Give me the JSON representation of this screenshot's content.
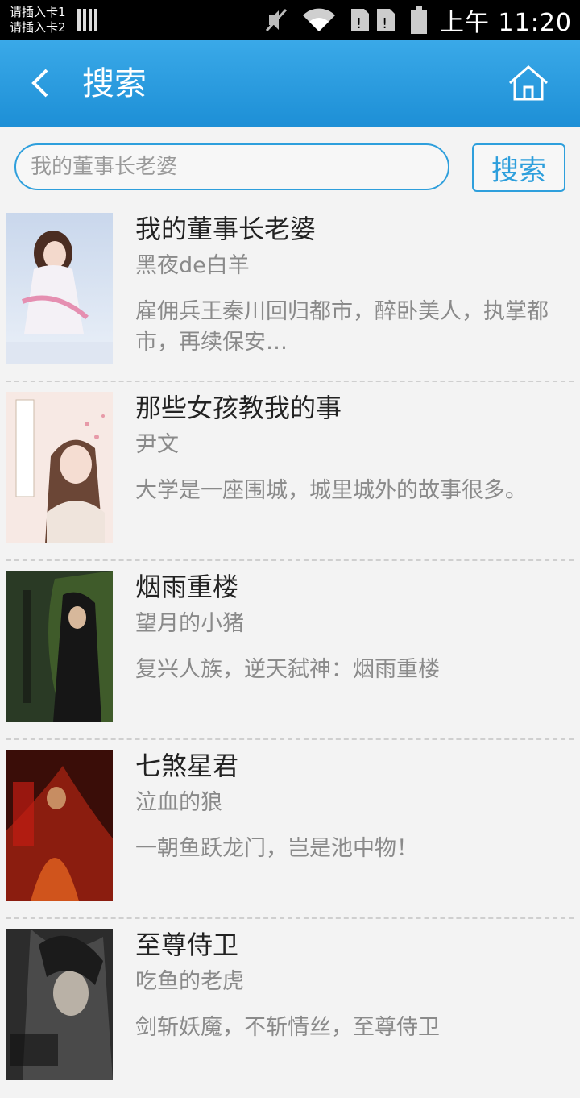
{
  "status": {
    "sim1": "请插入卡1",
    "sim2": "请插入卡2",
    "time": "上午 11:20"
  },
  "header": {
    "title": "搜索"
  },
  "search": {
    "value": "",
    "placeholder": "我的董事长老婆",
    "button_label": "搜索"
  },
  "books": [
    {
      "title": "我的董事长老婆",
      "author": "黑夜de白羊",
      "description": "雇佣兵王秦川回归都市，醉卧美人，执掌都市，再续保安…"
    },
    {
      "title": "那些女孩教我的事",
      "author": "尹文",
      "description": "大学是一座围城，城里城外的故事很多。"
    },
    {
      "title": "烟雨重楼",
      "author": "望月的小猪",
      "description": "复兴人族，逆天弑神：烟雨重楼"
    },
    {
      "title": "七煞星君",
      "author": "泣血的狼",
      "description": "一朝鱼跃龙门，岂是池中物！"
    },
    {
      "title": "至尊侍卫",
      "author": "吃鱼的老虎",
      "description": "剑斩妖魔，不斩情丝，至尊侍卫"
    }
  ],
  "colors": {
    "accent": "#2e9fdc",
    "header_top": "#3aa9e8",
    "header_bottom": "#1d8fd6"
  }
}
